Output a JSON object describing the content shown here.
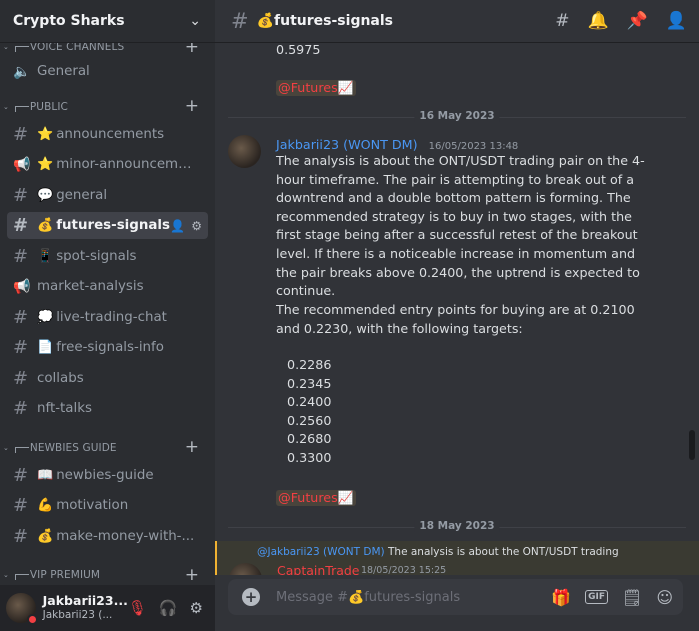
{
  "server": {
    "name": "Crypto Sharks"
  },
  "categories": {
    "voice": "VOICE CHANNELS",
    "public": "PUBLIC",
    "newbies": "NEWBIES GUIDE",
    "vip": "VIP PREMIUM"
  },
  "channels": {
    "general_voice": "General",
    "announcements": {
      "emoji": "⭐",
      "name": "announcements"
    },
    "minor": {
      "emoji": "⭐",
      "name": "minor-announceme..."
    },
    "general": {
      "emoji": "💬",
      "name": "general"
    },
    "futures": {
      "emoji": "💰",
      "name": "futures-signals"
    },
    "spot": {
      "emoji": "📱",
      "name": "spot-signals"
    },
    "market": {
      "name": "market-analysis"
    },
    "live": {
      "emoji": "💭",
      "name": "live-trading-chat"
    },
    "free": {
      "emoji": "📄",
      "name": "free-signals-info"
    },
    "collabs": {
      "name": "collabs"
    },
    "nft": {
      "name": "nft-talks"
    },
    "newbies": {
      "emoji": "📖",
      "name": "newbies-guide"
    },
    "motivation": {
      "emoji": "💪",
      "name": "motivation"
    },
    "money": {
      "emoji": "💰",
      "name": "make-money-with-..."
    }
  },
  "user": {
    "name": "Jakbarii23...",
    "tag": "Jakbarii23 (..."
  },
  "topbar": {
    "channel_emoji": "💰",
    "channel": "futures-signals"
  },
  "messages": {
    "prev_value": "0.5975",
    "prev_mention": "@Futures📈",
    "date1": "16 May 2023",
    "author": "Jakbarii23 (WONT DM)",
    "timestamp": "16/05/2023 13:48",
    "p1": "The analysis is about the ONT/USDT trading pair on the 4-hour timeframe. The pair is attempting to break out of a downtrend and a double bottom pattern is forming. The recommended strategy is to buy in two stages, with the first stage being after a successful retest of the breakout level. If there is a noticeable increase in momentum and the pair breaks above 0.2400, the uptrend is expected to continue.",
    "p2": "The recommended entry points for buying are at 0.2100 and 0.2230, with the following targets:",
    "targets": [
      "0.2286",
      "0.2345",
      "0.2400",
      "0.2560",
      "0.2680",
      "0.3300"
    ],
    "mention": "@Futures📈",
    "date2": "18 May 2023",
    "reply_name": "@Jakbarii23 (WONT DM)",
    "reply_text": "The analysis is about the ONT/USDT trading",
    "reply_author": "CaptainTrade",
    "reply_ts": "18/05/2023 15:25"
  },
  "composer": {
    "placeholder": "Message #💰futures-signals"
  }
}
